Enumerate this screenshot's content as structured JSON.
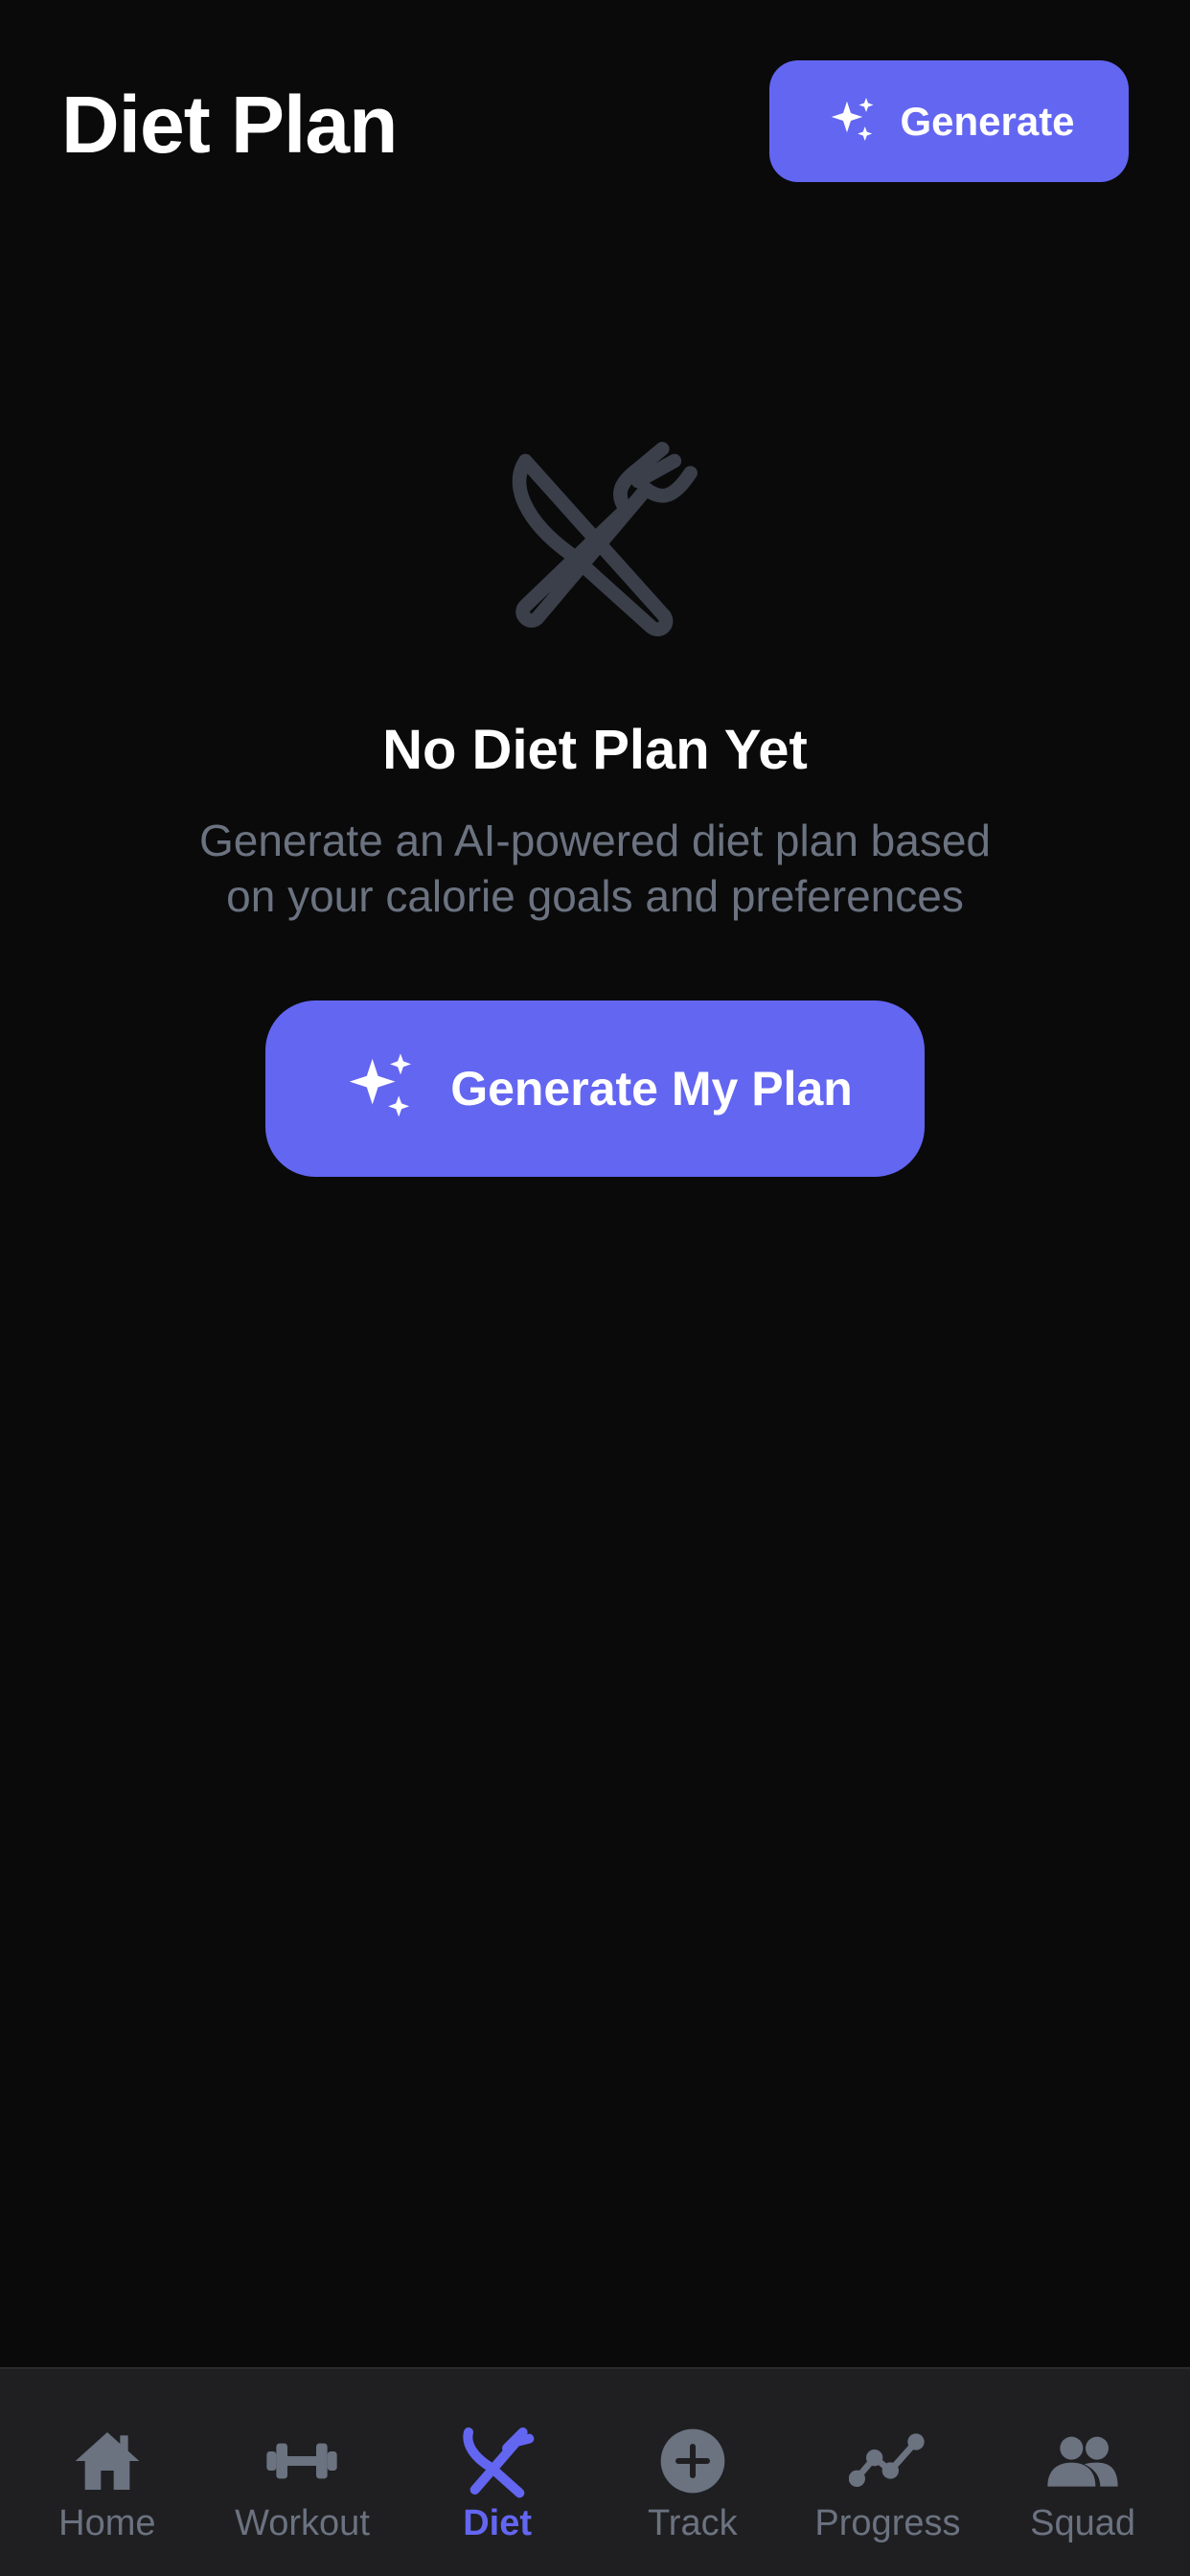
{
  "header": {
    "title": "Diet Plan",
    "generate_label": "Generate",
    "generate_icon": "sparkles-icon"
  },
  "empty_state": {
    "icon": "utensils-crossed-icon",
    "title": "No Diet Plan Yet",
    "description": "Generate an AI-powered diet plan based on your calorie goals and preferences",
    "button_label": "Generate My Plan",
    "button_icon": "sparkles-icon"
  },
  "tabbar": {
    "active": "Diet",
    "items": [
      {
        "label": "Home",
        "icon": "home-icon"
      },
      {
        "label": "Workout",
        "icon": "dumbbell-icon"
      },
      {
        "label": "Diet",
        "icon": "utensils-icon"
      },
      {
        "label": "Track",
        "icon": "plus-circle-icon"
      },
      {
        "label": "Progress",
        "icon": "trend-line-icon"
      },
      {
        "label": "Squad",
        "icon": "people-icon"
      }
    ]
  },
  "colors": {
    "background": "#0a0a0b",
    "accent": "#6366f1",
    "muted_text": "#6b7280",
    "icon_gray": "#374151",
    "tabbar_bg": "#1f1f21"
  }
}
